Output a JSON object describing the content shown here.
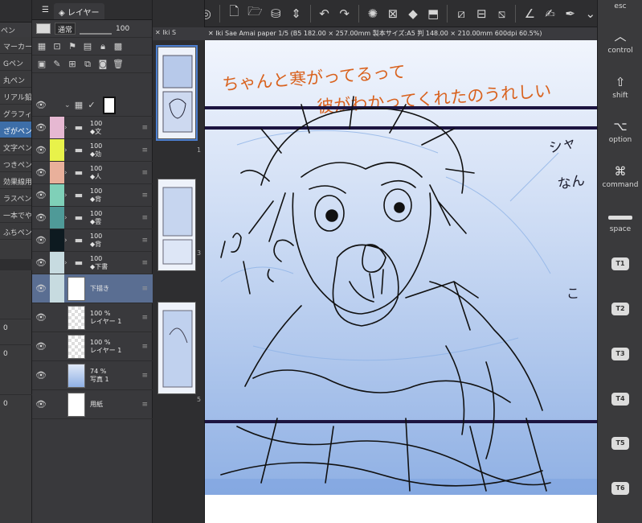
{
  "brushes": {
    "tab_label": "ペン",
    "items": [
      "マーカー",
      "Gペン",
      "丸ペン",
      "リアル鉛筆",
      "グラフィ",
      "ざがペン",
      "文字ペン",
      "つきペン",
      "効果線用",
      "ラスペン",
      "一本でや",
      "ふちペン"
    ],
    "selected_index": 5,
    "values": [
      "0",
      "0",
      "0"
    ]
  },
  "layers": {
    "tab_label": "レイヤー",
    "blend_mode": "通常",
    "opacity": "100",
    "rows": [
      {
        "pct": "",
        "name": "",
        "color": "",
        "type": "header"
      },
      {
        "pct": "100",
        "name": "◆文",
        "color": "#e6b8d2",
        "type": "folder"
      },
      {
        "pct": "100",
        "name": "◆効",
        "color": "#e8f24a",
        "type": "folder"
      },
      {
        "pct": "100",
        "name": "◆人",
        "color": "#e9b09b",
        "type": "folder"
      },
      {
        "pct": "100",
        "name": "◆背",
        "color": "#7fd0b8",
        "type": "folder"
      },
      {
        "pct": "100",
        "name": "◆雲",
        "color": "#4f9a98",
        "type": "folder"
      },
      {
        "pct": "100",
        "name": "◆背",
        "color": "#0d1a20",
        "type": "folder"
      },
      {
        "pct": "100",
        "name": "◆下書",
        "color": "#c7dbe0",
        "type": "folder"
      },
      {
        "pct": "",
        "name": "下描き",
        "color": "#c7dbe0",
        "type": "layer-sel"
      },
      {
        "pct": "100 %",
        "name": "レイヤー 1",
        "color": "",
        "type": "layer"
      },
      {
        "pct": "100 %",
        "name": "レイヤー 1",
        "color": "",
        "type": "layer"
      },
      {
        "pct": "74 %",
        "name": "写真 1",
        "color": "",
        "type": "photo"
      },
      {
        "pct": "",
        "name": "用紙",
        "color": "",
        "type": "paper"
      }
    ]
  },
  "pages": {
    "tab_label": "Iki S",
    "numbers": [
      "1",
      "3",
      "5"
    ]
  },
  "canvas": {
    "tab_label": "Iki Sae Amai paper 1/5 (B5 182.00 × 257.00mm 製本サイズ:A5 判 148.00 × 210.00mm 600dpi 60.5%)",
    "handwritten_line1": "ちゃんと寒がってるって",
    "handwritten_line2": "彼がわかってくれたのうれしい",
    "colors": {
      "ink": "#111111",
      "note": "#d9621e",
      "panel_border": "#1c1540",
      "blue": "#8fb3e6"
    }
  },
  "shortcuts": {
    "esc": "esc",
    "control": "control",
    "shift": "shift",
    "option": "option",
    "command": "command",
    "space": "space",
    "t1": "T1",
    "t2": "T2",
    "t3": "T3",
    "t4": "T4",
    "t5": "T5",
    "t6": "T6"
  }
}
